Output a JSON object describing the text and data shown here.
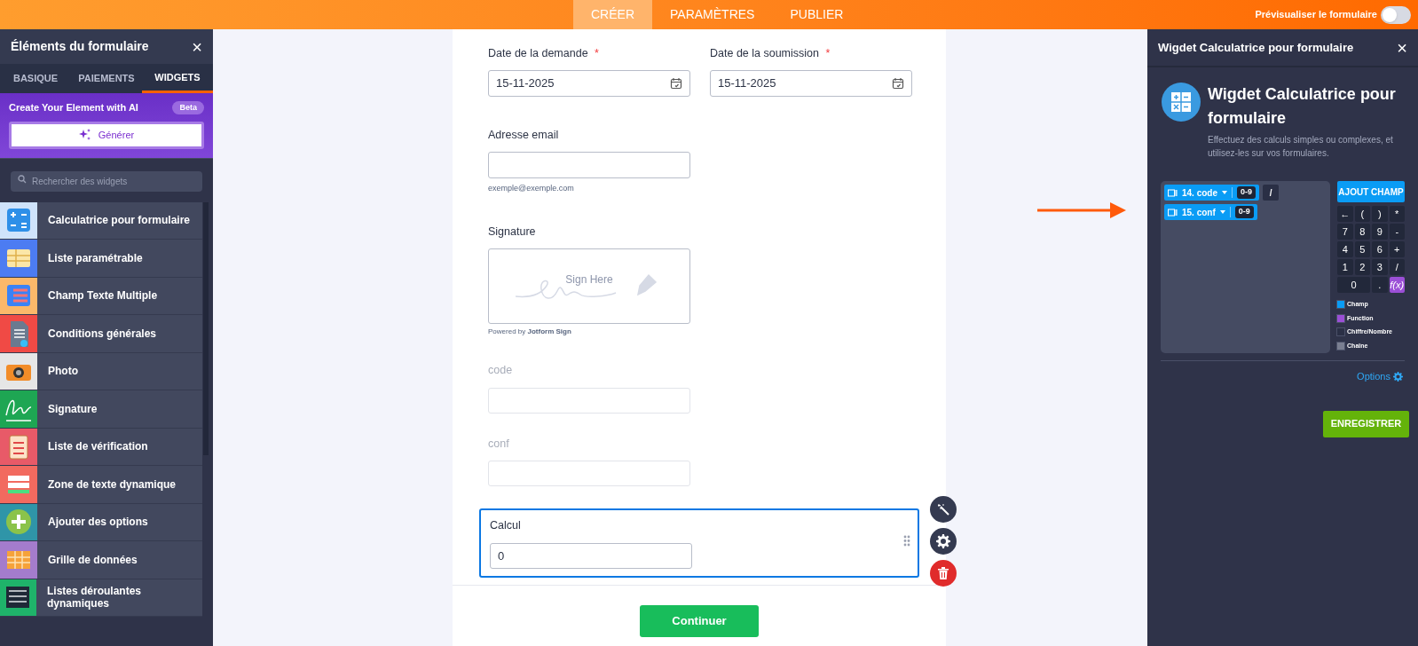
{
  "topbar": {
    "tabs": [
      {
        "label": "CRÉER",
        "selected": true
      },
      {
        "label": "PARAMÈTRES",
        "selected": false
      },
      {
        "label": "PUBLIER",
        "selected": false
      }
    ],
    "preview": {
      "label": "Prévisualiser le formulaire",
      "on": false
    }
  },
  "left_panel": {
    "title": "Éléments du formulaire",
    "close": "×",
    "tabs": [
      {
        "label": "BASIQUE",
        "selected": false
      },
      {
        "label": "PAIEMENTS",
        "selected": false
      },
      {
        "label": "WIDGETS",
        "selected": true
      }
    ],
    "ai": {
      "title": "Create Your Element with AI",
      "badge": "Beta",
      "button": "Générer"
    },
    "search": {
      "placeholder": "Rechercher des widgets"
    },
    "widgets": [
      {
        "label": "Calculatrice pour formulaire",
        "kind": "calculator",
        "color": "#cfe3fb"
      },
      {
        "label": "Liste paramétrable",
        "kind": "table",
        "color": "#4c7cf2"
      },
      {
        "label": "Champ Texte Multiple",
        "kind": "list",
        "color": "#fbb86a"
      },
      {
        "label": "Conditions générales",
        "kind": "document",
        "color": "#f04a45"
      },
      {
        "label": "Photo",
        "kind": "camera",
        "color": "#e6e6e6"
      },
      {
        "label": "Signature",
        "kind": "signature",
        "color": "#1ea653"
      },
      {
        "label": "Liste de vérification",
        "kind": "clipboard",
        "color": "#e85a68"
      },
      {
        "label": "Zone de texte dynamique",
        "kind": "textarea",
        "color": "#f26a5f"
      },
      {
        "label": "Ajouter des options",
        "kind": "plus",
        "color": "#2f95a8"
      },
      {
        "label": "Grille de données",
        "kind": "grid",
        "color": "#a47ccc"
      },
      {
        "label": "Listes déroulantes dynamiques",
        "kind": "dropdowns",
        "color": "#1fb36a"
      }
    ]
  },
  "form": {
    "dates": [
      {
        "label": "Date de la demande",
        "required": "*",
        "value": "15-11-2025"
      },
      {
        "label": "Date de la soumission",
        "required": "*",
        "value": "15-11-2025"
      }
    ],
    "email": {
      "label": "Adresse email",
      "hint": "exemple@exemple.com"
    },
    "signature": {
      "label": "Signature",
      "prompt": "Sign Here",
      "powered": "Powered by **Jotform Sign**"
    },
    "fields": [
      {
        "label": "code",
        "hidden": true,
        "selected": false
      },
      {
        "label": "conf",
        "hidden": true,
        "selected": false
      },
      {
        "label": "Calcul",
        "hidden": false,
        "selected": true,
        "value": "0"
      }
    ],
    "submit": "Continuer"
  },
  "right_panel": {
    "title": "Wigdet Calculatrice pour formulaire",
    "close": "×",
    "heading": "Wigdet Calculatrice pour formulaire",
    "description": "Effectuez des calculs simples ou complexes, et utilisez-les sur vos formulaires.",
    "formula": [
      {
        "kind": "field",
        "label": "14. code",
        "badge": "0-9"
      },
      {
        "kind": "operator",
        "label": "/"
      },
      {
        "kind": "field",
        "label": "15. conf",
        "badge": "0-9"
      }
    ],
    "add_field": "AJOUT CHAMP",
    "keys": [
      {
        "label": "←",
        "kind": "digit"
      },
      {
        "label": "(",
        "kind": "digit"
      },
      {
        "label": ")",
        "kind": "digit"
      },
      {
        "label": "*",
        "kind": "digit"
      },
      {
        "label": "7",
        "kind": "digit"
      },
      {
        "label": "8",
        "kind": "digit"
      },
      {
        "label": "9",
        "kind": "digit"
      },
      {
        "label": "-",
        "kind": "digit"
      },
      {
        "label": "4",
        "kind": "digit"
      },
      {
        "label": "5",
        "kind": "digit"
      },
      {
        "label": "6",
        "kind": "digit"
      },
      {
        "label": "+",
        "kind": "digit"
      },
      {
        "label": "1",
        "kind": "digit"
      },
      {
        "label": "2",
        "kind": "digit"
      },
      {
        "label": "3",
        "kind": "digit"
      },
      {
        "label": "/",
        "kind": "digit"
      },
      {
        "label": "0",
        "kind": "wide"
      },
      {
        "label": ".",
        "kind": "digit"
      },
      {
        "label": "f(x)",
        "kind": "function"
      }
    ],
    "legend": [
      {
        "label": "Champ",
        "color": "#0a9cf5"
      },
      {
        "label": "Function",
        "color": "#9b4fd6"
      },
      {
        "label": "Chiffre/Nombre",
        "color": "#2a2f45"
      },
      {
        "label": "Chaîne",
        "color": "#7a7f91"
      }
    ],
    "options": "Options",
    "save": "ENREGISTRER"
  }
}
